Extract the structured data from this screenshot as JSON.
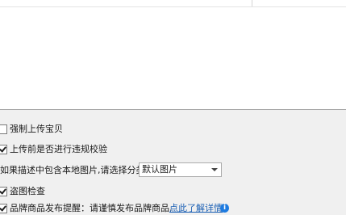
{
  "list": {
    "row1_col1": "",
    "row1_col2": ""
  },
  "options": {
    "force_upload": {
      "label": "强制上传宝贝",
      "checked": false
    },
    "violation_check": {
      "label": "上传前是否进行违规校验",
      "checked": true
    },
    "image_category": {
      "label": "如果描述中包含本地图片,请选择分类",
      "value": "默认图片"
    },
    "theft_check": {
      "label": "盗图检查",
      "checked": true
    },
    "brand_reminder": {
      "label": "品牌商品发布提醒：请谨慎发布品牌商品,",
      "link": "点此了解详情",
      "checked": true
    }
  },
  "icons": {
    "info": "info-icon"
  }
}
